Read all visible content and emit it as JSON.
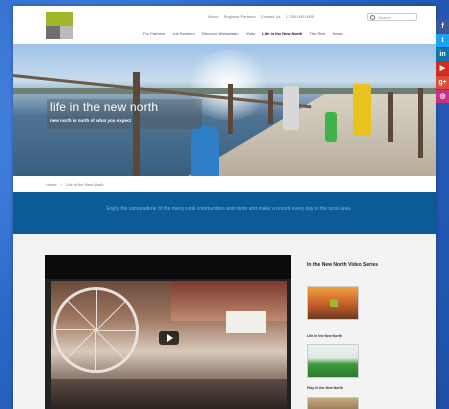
{
  "header": {
    "utility_links": [
      "About",
      "Regional Partners",
      "Contact Us",
      "1-780-000-0000"
    ],
    "search_placeholder": "Search",
    "nav": [
      {
        "label": "For Partners",
        "active": false
      },
      {
        "label": "Job Seekers",
        "active": false
      },
      {
        "label": "Discover Wetaskiwin",
        "active": false
      },
      {
        "label": "Visits",
        "active": false
      },
      {
        "label": "Life in the New North",
        "active": true
      },
      {
        "label": "The Rink",
        "active": false
      },
      {
        "label": "News",
        "active": false
      }
    ]
  },
  "hero": {
    "title": "life in the new north",
    "subtitle": "new north is north of what you expect"
  },
  "breadcrumb": [
    "Home",
    "Life in the New North"
  ],
  "band": {
    "text": "Enjoy the camaraderie of the many rural communities and more and make a record every day in the local area."
  },
  "sidebar": {
    "title": "In the New North Video Series",
    "items": [
      {
        "label": "Life in the New North"
      },
      {
        "label": "Play in the New North"
      }
    ]
  },
  "social": [
    {
      "icon": "facebook-icon",
      "glyph": "f",
      "color": "#3b5998"
    },
    {
      "icon": "twitter-icon",
      "glyph": "t",
      "color": "#1da1f2"
    },
    {
      "icon": "linkedin-icon",
      "glyph": "in",
      "color": "#0e76a8"
    },
    {
      "icon": "youtube-icon",
      "glyph": "▶",
      "color": "#d62d20"
    },
    {
      "icon": "google-plus-icon",
      "glyph": "g+",
      "color": "#dd4b39"
    },
    {
      "icon": "instagram-icon",
      "glyph": "◎",
      "color": "#c13584"
    }
  ],
  "colors": {
    "accent_green": "#9fb82a",
    "band_blue": "#0c5b96",
    "desktop_blue": "#2f6fd0"
  }
}
